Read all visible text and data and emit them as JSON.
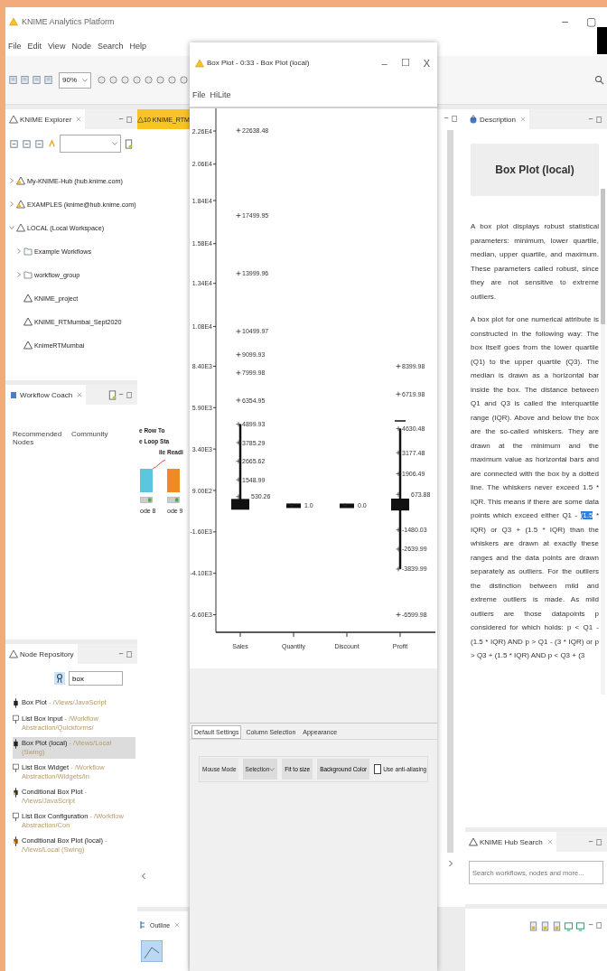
{
  "window": {
    "title": "KNIME Analytics Platform",
    "controls": [
      "–",
      "▢"
    ]
  },
  "menu": [
    "File",
    "Edit",
    "View",
    "Node",
    "Search",
    "Help"
  ],
  "toolbar": {
    "zoom": "90%"
  },
  "explorer": {
    "title": "KNIME Explorer",
    "tree": [
      {
        "label": "My-KNIME-Hub (hub.knime.com)",
        "kind": "server",
        "expanded": false
      },
      {
        "label": "EXAMPLES (knime@hub.knime.com)",
        "kind": "server",
        "expanded": false
      },
      {
        "label": "LOCAL (Local Workspace)",
        "kind": "workspace",
        "expanded": true,
        "children": [
          {
            "label": "Example Workflows",
            "kind": "folder",
            "expanded": false
          },
          {
            "label": "workflow_group",
            "kind": "folder",
            "expanded": false
          },
          {
            "label": "KNIME_project",
            "kind": "workflow"
          },
          {
            "label": "KNIME_RTMumbai_Sept2020",
            "kind": "workflow"
          },
          {
            "label": "KnimeRTMumbai",
            "kind": "workflow"
          }
        ]
      }
    ]
  },
  "coach": {
    "title": "Workflow Coach",
    "columns": [
      "Recommended Nodes",
      "Community"
    ]
  },
  "repository": {
    "title": "Node Repository",
    "search": "box",
    "items": [
      {
        "name": "Box Plot",
        "path": "- /Views/JavaScript",
        "kind": "boxplot",
        "selected": false
      },
      {
        "name": "List Box Input",
        "path": "- /Workflow Abstraction/Quickforms/",
        "kind": "listbox",
        "selected": false
      },
      {
        "name": "Box Plot (local)",
        "path": "- /Views/Local (Swing)",
        "kind": "boxplot",
        "selected": true
      },
      {
        "name": "List Box Widget",
        "path": "- /Workflow Abstraction/Widgets/In",
        "kind": "listbox",
        "selected": false
      },
      {
        "name": "Conditional Box Plot",
        "path": "- /Views/JavaScript",
        "kind": "conditional",
        "selected": false
      },
      {
        "name": "List Box Configuration",
        "path": "- /Workflow Abstraction/Con",
        "kind": "listbox",
        "selected": false
      },
      {
        "name": "Conditional Box Plot (local)",
        "path": "- /Views/Local (Swing)",
        "kind": "conditional-local",
        "selected": false
      }
    ]
  },
  "editor": {
    "tab": "10 KNIME_RTM",
    "labels": [
      "e Row To",
      "e Loop Sta",
      "ile Readi"
    ],
    "nodes": [
      {
        "label": "ode 8",
        "color": "#5cc6e0"
      },
      {
        "label": "ode 9",
        "color": "#f08a24"
      }
    ]
  },
  "boxplot_window": {
    "title": "Box Plot - 0:33 - Box Plot (local)",
    "controls": [
      "–",
      "☐",
      "X"
    ],
    "menu": [
      "File",
      "HiLite"
    ],
    "chart_data": {
      "type": "scatter",
      "categories": [
        "Sales",
        "Quantity",
        "Discount",
        "Profit"
      ],
      "yticks": [
        {
          "value": 22600,
          "label": "2.26E4"
        },
        {
          "value": 20600,
          "label": "2.06E4"
        },
        {
          "value": 18400,
          "label": "1.84E4"
        },
        {
          "value": 15800,
          "label": "1.58E4"
        },
        {
          "value": 13400,
          "label": "1.34E4"
        },
        {
          "value": 10800,
          "label": "1.08E4"
        },
        {
          "value": 8400,
          "label": "8.40E3"
        },
        {
          "value": 5900,
          "label": "5.90E3"
        },
        {
          "value": 3400,
          "label": "3.40E3"
        },
        {
          "value": 900,
          "label": "9.00E2"
        },
        {
          "value": -1600,
          "label": "-1.60E3"
        },
        {
          "value": -4100,
          "label": "-4.10E3"
        },
        {
          "value": -6600,
          "label": "-6.60E3"
        }
      ],
      "ylim": [
        -7660,
        23964
      ],
      "series": [
        {
          "color": "#222222",
          "values": [
            22640,
            0,
            0,
            8400
          ]
        },
        {
          "color": "#222222",
          "values": [
            17500,
            null,
            null,
            6720
          ]
        },
        {
          "color": "#222222",
          "values": [
            14000,
            null,
            null,
            4630
          ]
        },
        {
          "color": "#222222",
          "values": [
            10500,
            null,
            null,
            3180
          ]
        },
        {
          "color": "#222222",
          "values": [
            9100,
            null,
            null,
            1910
          ]
        },
        {
          "color": "#222222",
          "values": [
            8000,
            null,
            null,
            670
          ]
        },
        {
          "color": "#222222",
          "values": [
            6350,
            null,
            null,
            -1480
          ]
        },
        {
          "color": "#222222",
          "values": [
            4900,
            null,
            null,
            -2640
          ]
        },
        {
          "color": "#222222",
          "values": [
            3790,
            null,
            null,
            -3840
          ]
        },
        {
          "color": "#222222",
          "values": [
            2670,
            null,
            null,
            -6600
          ]
        },
        {
          "color": "#222222",
          "values": [
            1550,
            null,
            null,
            null
          ]
        },
        {
          "color": "#222222",
          "values": [
            530,
            null,
            null,
            null
          ]
        }
      ],
      "annotations": [
        "22638.48",
        "1.0",
        "0.0",
        "8399.98",
        "17499.95",
        "6719.98",
        "13999.96",
        "4630.48",
        "10499.97",
        "3177.48",
        "9099.93",
        "1906.49",
        "7999.98",
        "673.88",
        "6354.95",
        "-1480.03",
        "4899.93",
        "-2639.99",
        "3785.29",
        "-3839.99",
        "2665.62",
        "-6599.98",
        "1548.99",
        "530.26"
      ]
    },
    "tabs": [
      {
        "label": "Default Settings",
        "selected": true
      },
      {
        "label": "Column Selection",
        "selected": false
      },
      {
        "label": "Appearance",
        "selected": false
      }
    ],
    "mouse_mode_label": "Mouse Mode",
    "mouse_mode": "Selection",
    "buttons": [
      "Fit to size",
      "Background Color"
    ],
    "anti_aliasing": {
      "label": "Use anti-aliasing",
      "checked": false
    }
  },
  "description": {
    "title": "Description",
    "heading": "Box Plot (local)",
    "paragraphs": [
      {
        "text": "A box plot displays robust statistical parameters: minimum, lower quartile, median, upper quartile, and maximum. These parameters called robust, since they are not sensitive to extreme outliers."
      },
      {
        "text": "A box plot for one numerical attribute is constructed in the following way: The box itself goes from the lower quartile (Q1) to the upper quartile (Q3). The median is drawn as a horizontal bar inside the box. The distance between Q1 and Q3 is called the interquartile range (IQR). Above and below the box are the so-called whiskers. They are drawn at the minimum and the maximum value as horizontal bars and are connected with the box by a dotted line. The whiskers never exceed 1.5 * IQR. This means if there are some data points which exceed either Q1 - ",
        "highlight": "(1.5",
        "text_after": " * IQR) or Q3 + (1.5 * IQR) than the whiskers are drawn at exactly these ranges and the data points are drawn separately as outliers. For the outliers the distinction between mild and extreme outliers is made. As mild outliers are those datapoints p considered for which holds: p < Q1 - (1.5 * IQR) AND p > Q1 - (3 * IQR) or p > Q3 + (1.5 * IQR) AND p < Q3 + (3"
      }
    ]
  },
  "hub_search": {
    "title": "KNIME Hub Search",
    "placeholder": "Search workflows, nodes and more..."
  },
  "outline": {
    "title": "Outline"
  }
}
